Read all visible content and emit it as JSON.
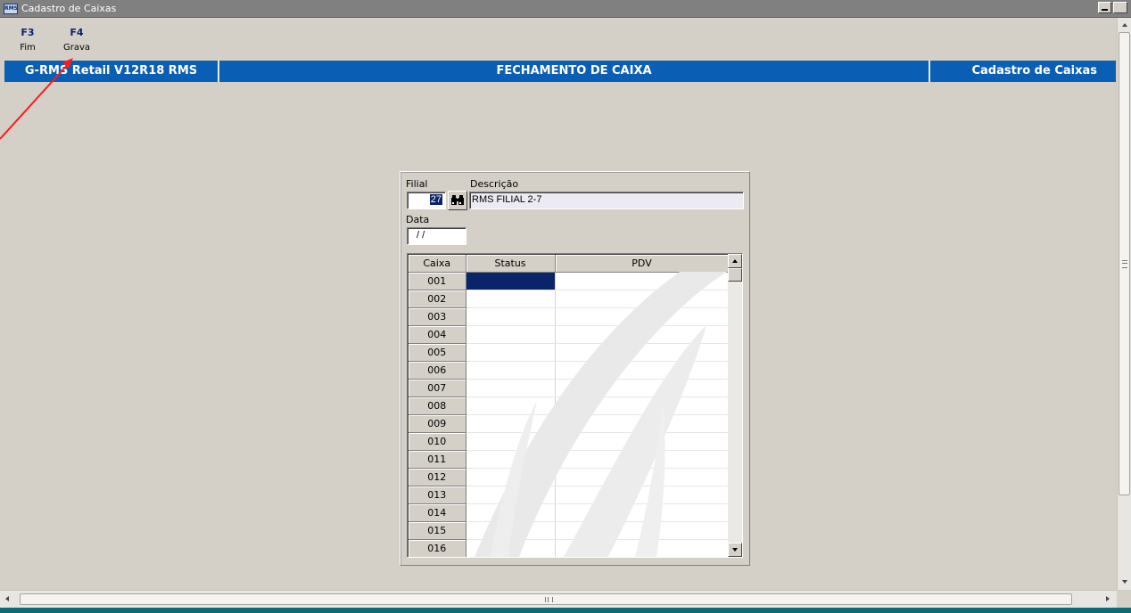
{
  "window": {
    "icon_text": "RMS",
    "title": "Cadastro de Caixas"
  },
  "toolbar": {
    "f3_key": "F3",
    "f3_label": "Fim",
    "f4_key": "F4",
    "f4_label": "Grava"
  },
  "header": {
    "left": "G-RMS Retail V12R18 RMS",
    "center": "FECHAMENTO DE CAIXA",
    "right": "Cadastro de Caixas"
  },
  "form": {
    "filial_label": "Filial",
    "filial_value": "27",
    "descricao_label": "Descrição",
    "descricao_value": "RMS FILIAL 2-7",
    "data_label": "Data",
    "data_value": " / /"
  },
  "grid": {
    "columns": [
      "Caixa",
      "Status",
      "PDV"
    ],
    "rows": [
      {
        "caixa": "001",
        "status": "",
        "pdv": ""
      },
      {
        "caixa": "002",
        "status": "",
        "pdv": ""
      },
      {
        "caixa": "003",
        "status": "",
        "pdv": ""
      },
      {
        "caixa": "004",
        "status": "",
        "pdv": ""
      },
      {
        "caixa": "005",
        "status": "",
        "pdv": ""
      },
      {
        "caixa": "006",
        "status": "",
        "pdv": ""
      },
      {
        "caixa": "007",
        "status": "",
        "pdv": ""
      },
      {
        "caixa": "008",
        "status": "",
        "pdv": ""
      },
      {
        "caixa": "009",
        "status": "",
        "pdv": ""
      },
      {
        "caixa": "010",
        "status": "",
        "pdv": ""
      },
      {
        "caixa": "011",
        "status": "",
        "pdv": ""
      },
      {
        "caixa": "012",
        "status": "",
        "pdv": ""
      },
      {
        "caixa": "013",
        "status": "",
        "pdv": ""
      },
      {
        "caixa": "014",
        "status": "",
        "pdv": ""
      },
      {
        "caixa": "015",
        "status": "",
        "pdv": ""
      },
      {
        "caixa": "016",
        "status": "",
        "pdv": ""
      }
    ]
  },
  "colors": {
    "header_blue": "#0a5fb4",
    "selection_navy": "#0a246a",
    "annotation_red": "#ff1a1a"
  }
}
